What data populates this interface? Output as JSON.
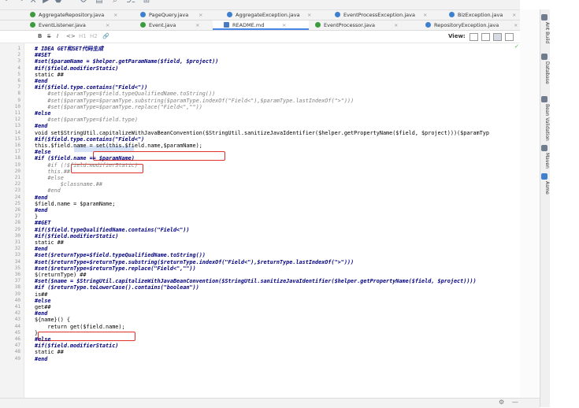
{
  "toolbar": {
    "icons": [
      "undo-icon",
      "redo-icon",
      "build-icon",
      "run-icon",
      "debug-icon",
      "search-icon",
      "settings-icon",
      "structure-icon",
      "vcs-icon"
    ]
  },
  "tabs_row1": [
    {
      "label": "AggregateRepository.java",
      "icon": "interface"
    },
    {
      "label": "PageQuery.java",
      "icon": "class"
    },
    {
      "label": "AggregateException.java",
      "icon": "class"
    },
    {
      "label": "EventProcessException.java",
      "icon": "class"
    },
    {
      "label": "BizException.java",
      "icon": "class"
    }
  ],
  "tabs_row2": [
    {
      "label": "EventListener.java",
      "icon": "interface"
    },
    {
      "label": "Event.java",
      "icon": "interface"
    },
    {
      "label": "README.md",
      "icon": "markdown"
    },
    {
      "label": "EventProcessor.java",
      "icon": "interface"
    },
    {
      "label": "RepositoryException.java",
      "icon": "class"
    }
  ],
  "md_toolbar": {
    "bold": "B",
    "strike": "S",
    "italic": "I",
    "code": "<>",
    "h1": "H1",
    "h2": "H2",
    "link": "🔗",
    "view_label": "View:"
  },
  "code_lines": [
    {
      "n": "1",
      "t": "# IDEA GET和SET代码生成",
      "s": "b"
    },
    {
      "n": "2",
      "t": "##SET",
      "s": "b"
    },
    {
      "n": "3",
      "t": "#set($paramName = $helper.getParamName($field, $project))",
      "s": "b"
    },
    {
      "n": "4",
      "t": "#if($field.modifierStatic)",
      "s": "b"
    },
    {
      "n": "5",
      "t": "static ##",
      "s": "n"
    },
    {
      "n": "6",
      "t": "#end",
      "s": "b"
    },
    {
      "n": "7",
      "t": "#if($field.type.contains(\"Field<\"))",
      "s": "b"
    },
    {
      "n": "8",
      "t": "    #set($paramType=$field.typeQualifiedName.toString())",
      "s": "c"
    },
    {
      "n": "9",
      "t": "    #set($paramType=$paramType.substring($paramType.indexOf(\"Field<\"),$paramType.lastIndexOf(\">\")))",
      "s": "c"
    },
    {
      "n": "10",
      "t": "    #set($paramType=$paramType.replace(\"Field<\",\"\"))",
      "s": "c"
    },
    {
      "n": "11",
      "t": "#else",
      "s": "b"
    },
    {
      "n": "12",
      "t": "    #set($paramType=$field.type)",
      "s": "c"
    },
    {
      "n": "13",
      "t": "#end",
      "s": "b"
    },
    {
      "n": "14",
      "t": "void set$StringUtil.capitalizeWithJavaBeanConvention($StringUtil.sanitizeJavaIdentifier($helper.getPropertyName($field, $project)))($paramTyp",
      "s": "n"
    },
    {
      "n": "15",
      "t": "#if($field.type.contains(\"Field<\")",
      "s": "b"
    },
    {
      "n": "16",
      "t": "this.$field.name = set(this.$field.name,$paramName);",
      "s": "n"
    },
    {
      "n": "17",
      "t": "#else",
      "s": "b"
    },
    {
      "n": "18",
      "t": "#if ($field.name == $paramName)",
      "s": "b"
    },
    {
      "n": "19",
      "t": "    #if (!$field.modifierStatic)",
      "s": "c"
    },
    {
      "n": "20",
      "t": "    this.##",
      "s": "c"
    },
    {
      "n": "21",
      "t": "    #else",
      "s": "c"
    },
    {
      "n": "22",
      "t": "        $classname.##",
      "s": "c"
    },
    {
      "n": "23",
      "t": "    #end",
      "s": "c"
    },
    {
      "n": "24",
      "t": "#end",
      "s": "b"
    },
    {
      "n": "25",
      "t": "$field.name = $paramName;",
      "s": "n"
    },
    {
      "n": "26",
      "t": "#end",
      "s": "b"
    },
    {
      "n": "27",
      "t": "}",
      "s": "n"
    },
    {
      "n": "28",
      "t": "##GET",
      "s": "b"
    },
    {
      "n": "29",
      "t": "#if($field.typeQualifiedName.contains(\"Field<\"))",
      "s": "b"
    },
    {
      "n": "30",
      "t": "#if($field.modifierStatic)",
      "s": "b"
    },
    {
      "n": "31",
      "t": "static ##",
      "s": "n"
    },
    {
      "n": "32",
      "t": "#end",
      "s": "b"
    },
    {
      "n": "33",
      "t": "#set($returnType=$field.typeQualifiedName.toString())",
      "s": "b"
    },
    {
      "n": "34",
      "t": "#set($returnType=$returnType.substring($returnType.indexOf(\"Field<\"),$returnType.lastIndexOf(\">\")))",
      "s": "b"
    },
    {
      "n": "35",
      "t": "#set($returnType=$returnType.replace(\"Field<\",\"\"))",
      "s": "b"
    },
    {
      "n": "36",
      "t": "$(returnType) ##",
      "s": "n"
    },
    {
      "n": "37",
      "t": "#set($name = $StringUtil.capitalizeWithJavaBeanConvention($StringUtil.sanitizeJavaIdentifier($helper.getPropertyName($field, $project))))",
      "s": "b"
    },
    {
      "n": "38",
      "t": "#if ($returnType.toLowerCase().contains(\"boolean\"))",
      "s": "b"
    },
    {
      "n": "39",
      "t": "is##",
      "s": "n"
    },
    {
      "n": "40",
      "t": "#else",
      "s": "b"
    },
    {
      "n": "41",
      "t": "get##",
      "s": "n"
    },
    {
      "n": "42",
      "t": "#end",
      "s": "b"
    },
    {
      "n": "43",
      "t": "${name}() {",
      "s": "n"
    },
    {
      "n": "44",
      "t": "    return get($field.name);",
      "s": "n"
    },
    {
      "n": "45",
      "t": "}",
      "s": "n"
    },
    {
      "n": "46",
      "t": "#else",
      "s": "b"
    },
    {
      "n": "47",
      "t": "#if($field.modifierStatic)",
      "s": "b"
    },
    {
      "n": "48",
      "t": "static ##",
      "s": "n"
    },
    {
      "n": "49",
      "t": "#end",
      "s": "b"
    }
  ],
  "right_sidebar": [
    "Ant Build",
    "Database",
    "Bean Validation",
    "Maven",
    "Asme"
  ],
  "status": {
    "gear": "⚙",
    "minus": "—"
  },
  "colors": {
    "highlight_border": "#e0312b",
    "directive": "#000080",
    "comment": "#7f7f7f"
  }
}
